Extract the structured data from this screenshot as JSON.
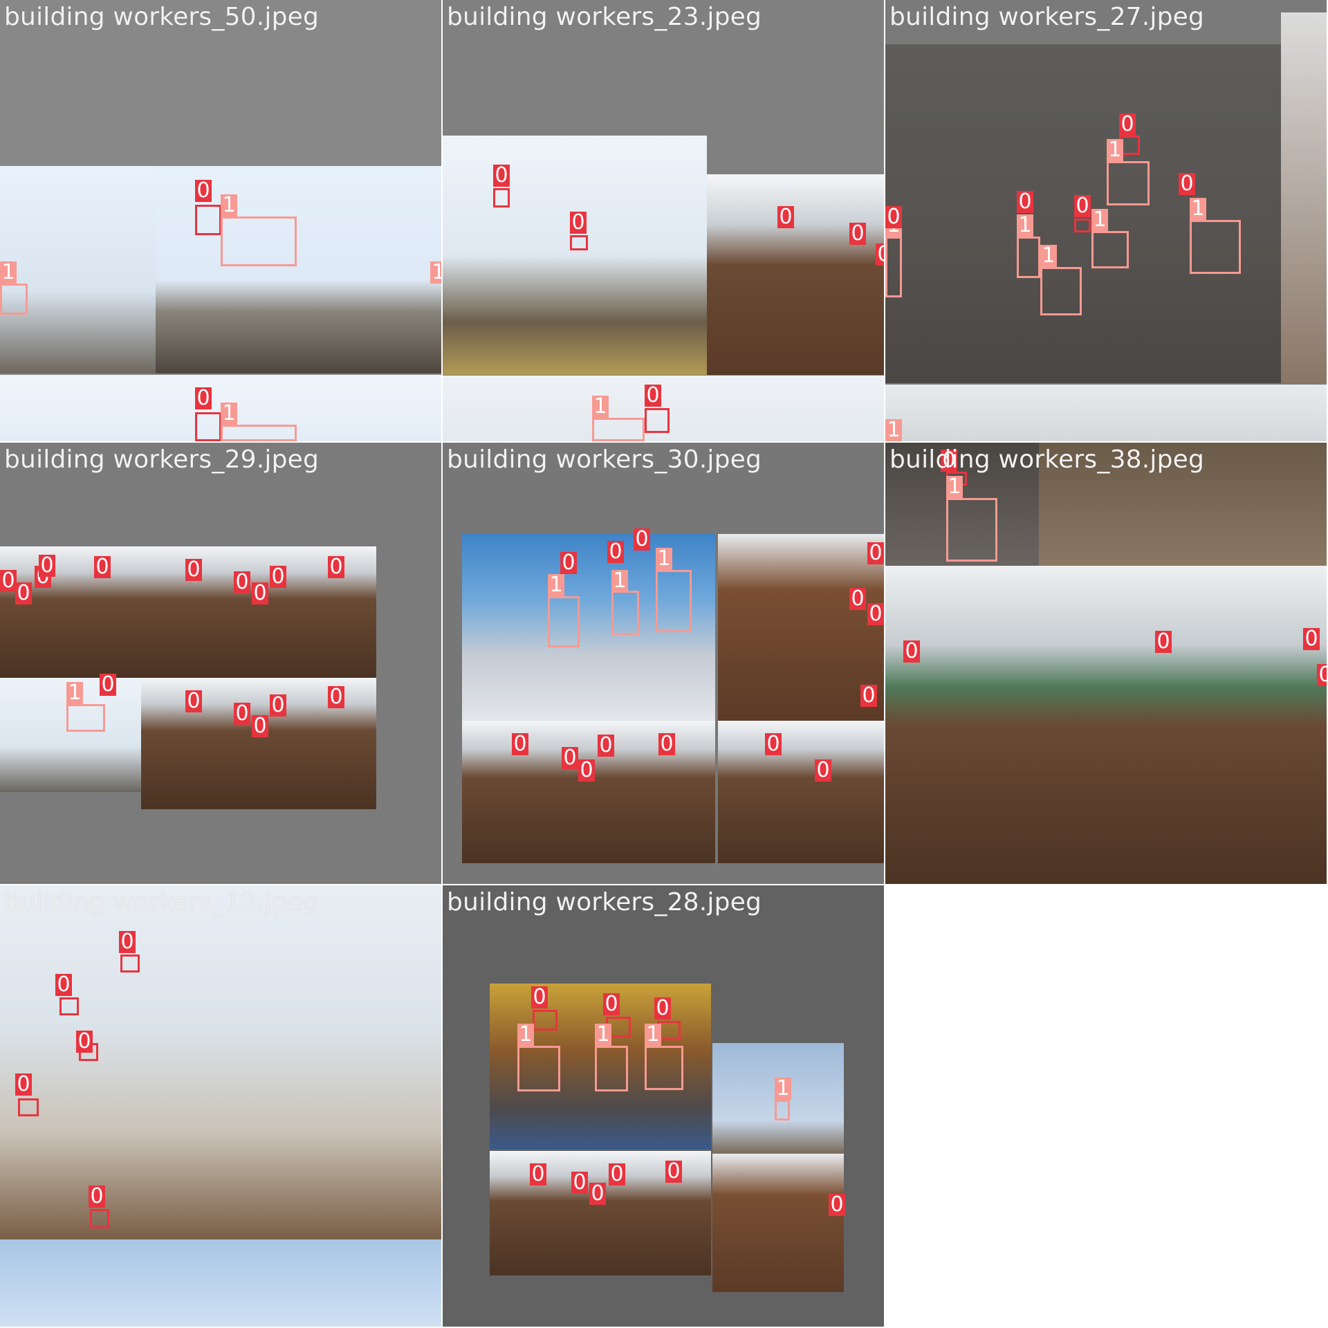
{
  "colors": {
    "class0": "#e8343f",
    "class1": "#f79a93",
    "pad": "#777777",
    "grid_line": "#ffffff"
  },
  "tiles": [
    {
      "title": "building workers_50.jpeg",
      "labels": [
        "0",
        "1",
        "1",
        "1",
        "0",
        "1"
      ]
    },
    {
      "title": "building workers_23.jpeg",
      "labels": [
        "0",
        "0",
        "0",
        "0",
        "0",
        "1",
        "0"
      ]
    },
    {
      "title": "building workers_27.jpeg",
      "labels": [
        "0",
        "1",
        "0",
        "0",
        "0",
        "1",
        "1",
        "1",
        "1",
        "1",
        "0",
        "1"
      ]
    },
    {
      "title": "building workers_29.jpeg",
      "labels": [
        "0",
        "0",
        "0",
        "0",
        "0",
        "0",
        "0",
        "0",
        "0",
        "0",
        "1",
        "0",
        "0",
        "0",
        "0",
        "0",
        "0"
      ]
    },
    {
      "title": "building workers_30.jpeg",
      "labels": [
        "0",
        "0",
        "0",
        "1",
        "1",
        "1",
        "0",
        "0",
        "0",
        "0",
        "0",
        "0",
        "0",
        "0",
        "0",
        "0",
        "0"
      ]
    },
    {
      "title": "building workers_38.jpeg",
      "labels": [
        "0",
        "1",
        "0",
        "0",
        "0",
        "0"
      ]
    },
    {
      "title": "building workers_12.jpeg",
      "labels": [
        "0",
        "0",
        "0",
        "0",
        "0"
      ]
    },
    {
      "title": "building workers_28.jpeg",
      "labels": [
        "0",
        "0",
        "0",
        "1",
        "1",
        "1",
        "1",
        "0",
        "0",
        "0",
        "0",
        "0",
        "0"
      ]
    }
  ]
}
